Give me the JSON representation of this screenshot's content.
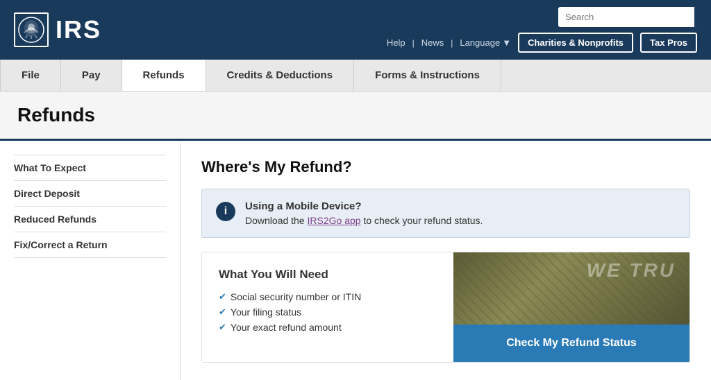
{
  "header": {
    "logo_text": "IRS",
    "search_placeholder": "Search",
    "links": {
      "help": "Help",
      "news": "News",
      "language": "Language"
    },
    "buttons": {
      "charities": "Charities & Nonprofits",
      "tax_pros": "Tax Pros"
    }
  },
  "nav": {
    "items": [
      {
        "label": "File",
        "active": false
      },
      {
        "label": "Pay",
        "active": false
      },
      {
        "label": "Refunds",
        "active": true
      },
      {
        "label": "Credits & Deductions",
        "active": false
      },
      {
        "label": "Forms & Instructions",
        "active": false
      }
    ]
  },
  "page_title": "Refunds",
  "sidebar": {
    "items": [
      {
        "label": "What To Expect"
      },
      {
        "label": "Direct Deposit"
      },
      {
        "label": "Reduced Refunds"
      },
      {
        "label": "Fix/Correct a Return"
      }
    ]
  },
  "main": {
    "heading": "Where's My Refund?",
    "info_box": {
      "icon": "i",
      "title": "Using a Mobile Device?",
      "text_before_link": "Download the ",
      "link_text": "IRS2Go app",
      "text_after_link": " to check your refund status."
    },
    "card": {
      "title": "What You Will Need",
      "checklist": [
        "Social security number or ITIN",
        "Your filing status",
        "Your exact refund amount"
      ],
      "money_overlay": "WE TRU",
      "button_label": "Check My Refund Status"
    }
  }
}
